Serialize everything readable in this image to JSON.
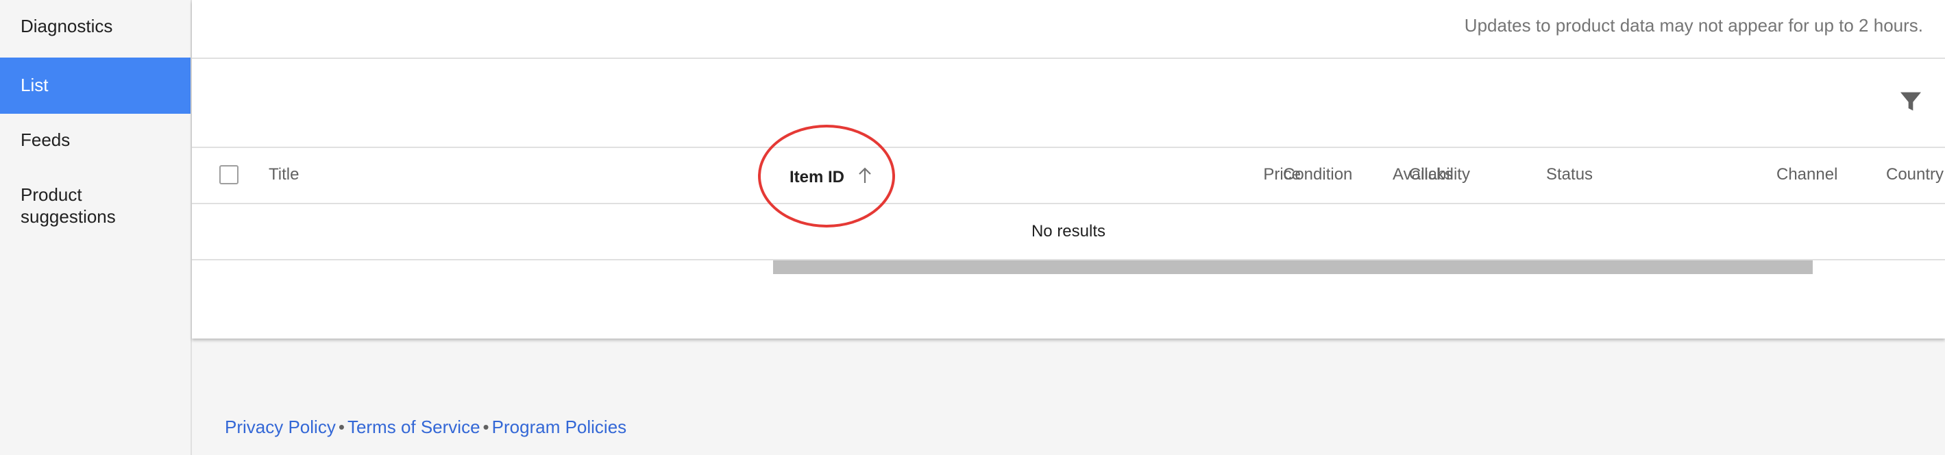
{
  "sidebar": {
    "items": [
      {
        "label": "Diagnostics",
        "active": false
      },
      {
        "label": "List",
        "active": true
      },
      {
        "label": "Feeds",
        "active": false
      },
      {
        "label": "Product suggestions",
        "active": false
      }
    ]
  },
  "notice": "Updates to product data may not appear for up to 2 hours.",
  "toolbar": {
    "filter_icon": "filter-icon"
  },
  "table": {
    "columns": [
      "Title",
      "Item ID",
      "Price",
      "Clicks",
      "Condition",
      "Availability",
      "Status",
      "Channel",
      "Country"
    ],
    "sorted_column": "Item ID",
    "sort_direction": "ascending",
    "empty_message": "No results"
  },
  "footer": {
    "links": [
      "Privacy Policy",
      "Terms of Service",
      "Program Policies"
    ],
    "separator": "•"
  },
  "colors": {
    "accent": "#4285f4",
    "link": "#3367d6",
    "annotation": "#e53935"
  }
}
